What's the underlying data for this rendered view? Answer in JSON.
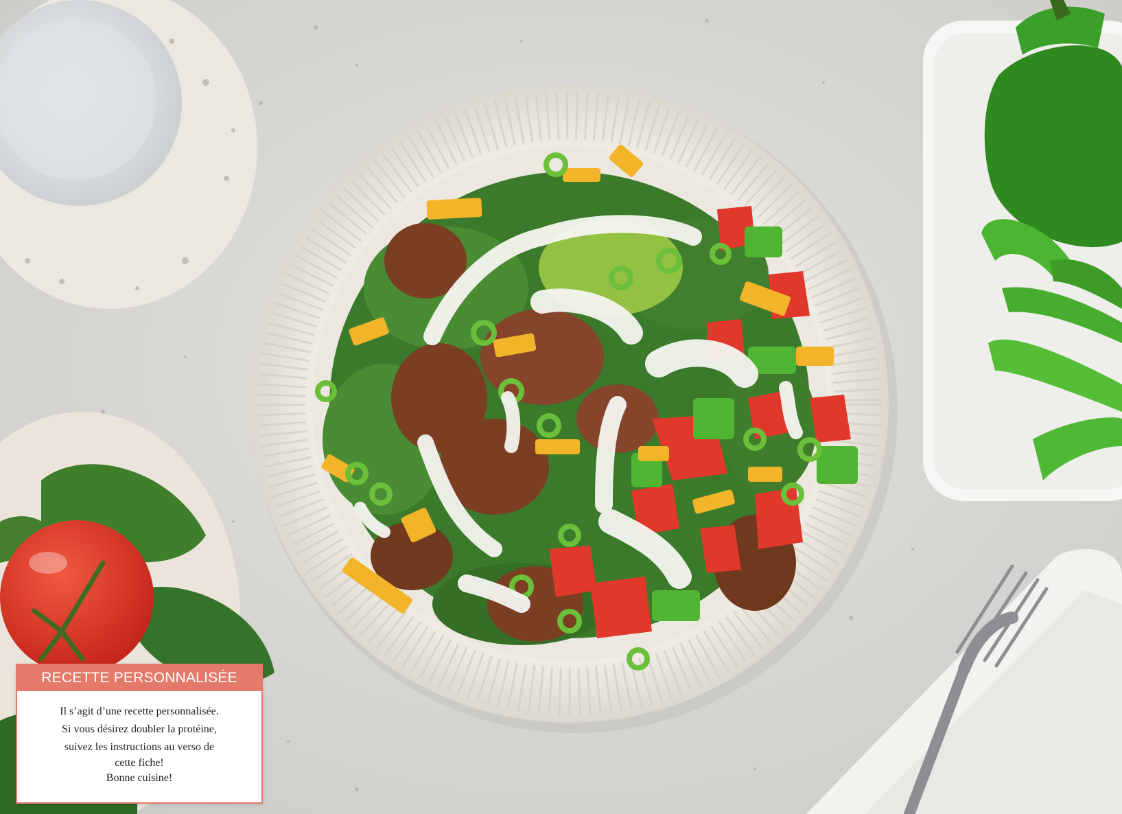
{
  "badge": {
    "title": "RECETTE PERSONNALISÉE",
    "lines": [
      "Il s’agit d’une recette personnalisée.",
      "Si vous désirez doubler la protéine,",
      "suivez les instructions au verso de",
      "cette fiche!",
      "Bonne cuisine!"
    ]
  },
  "colors": {
    "badge_accent": "#e57a6a",
    "countertop": "#d9d8d4",
    "spinach": "#3f7f2c",
    "tomato": "#e0382a",
    "cheddar": "#f2b52a",
    "beef": "#7a3f22",
    "green_pepper": "#3fa128"
  }
}
